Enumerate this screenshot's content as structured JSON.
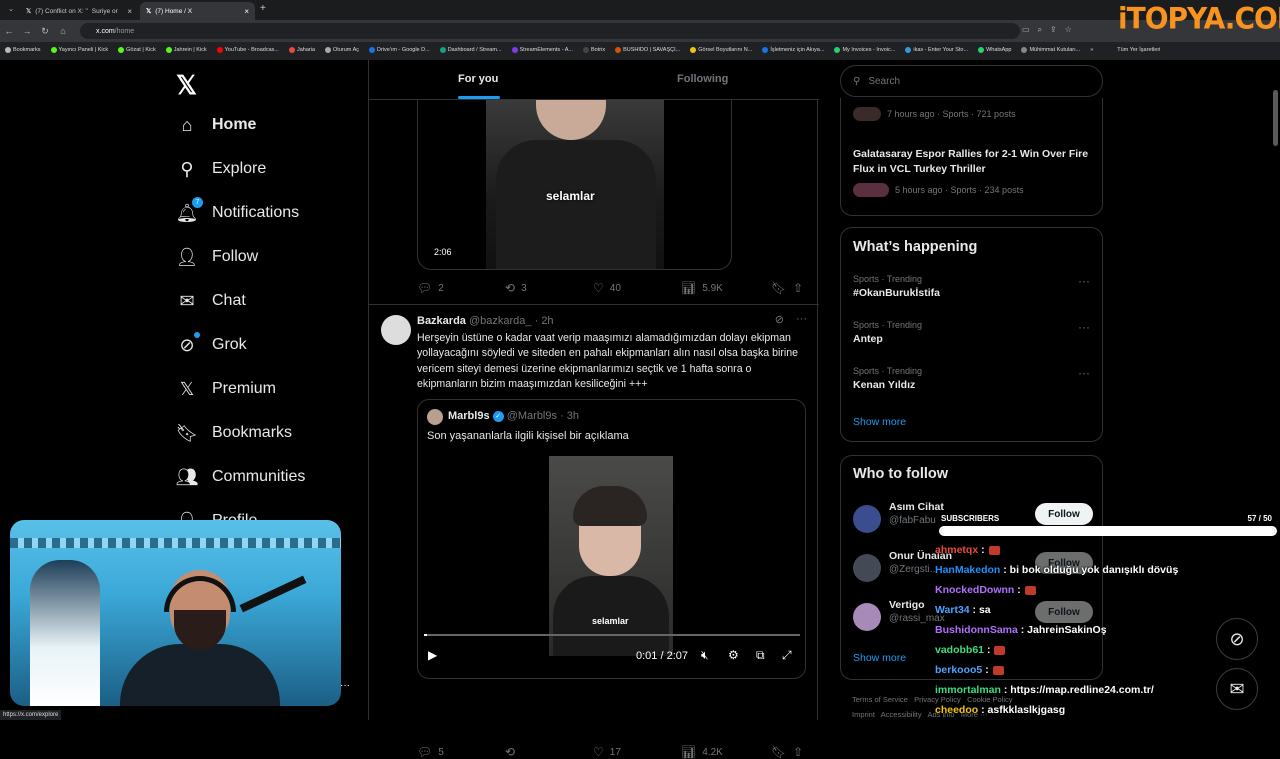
{
  "browser": {
    "tabs": [
      {
        "label": "(7) Conflict on X: \"",
        "active": false
      },
      {
        "label": "Suriye or",
        "active": false
      },
      {
        "label": "(7) Home / X",
        "active": true
      }
    ],
    "new_tab": "+",
    "url_host": "x.com",
    "url_path": "/home",
    "watermark": "iTOPYA.COM",
    "bookmarks": [
      "Bookmarks",
      "Yayıncı Paneli | Kick",
      "Gözat | Kick",
      "Jahrein | Kick",
      "YouTube - Broadcas...",
      "Jaharia",
      "Oturum Aç",
      "Drive'ım - Google D...",
      "Dashboard / Stream...",
      "StreamElements - A...",
      "Botrix",
      "BUSHIDO | SAVAŞÇI...",
      "Görsel Boyutlarını N...",
      "İşletmeniz için Akıya...",
      "My Invoices - Invoic...",
      "ikas - Enter Your Sto...",
      "WhatsApp",
      "Mühimmat Kutuları..."
    ],
    "bookmarks_more": "»",
    "all_bookmarks": "Tüm Yer İşaretleri",
    "status_url": "https://x.com/explore"
  },
  "nav": {
    "logo": "𝕏",
    "items": [
      {
        "label": "Home",
        "icon": "home-icon"
      },
      {
        "label": "Explore",
        "icon": "search-icon"
      },
      {
        "label": "Notifications",
        "icon": "bell-icon",
        "badge": "7"
      },
      {
        "label": "Follow",
        "icon": "person-plus-icon"
      },
      {
        "label": "Chat",
        "icon": "mail-icon"
      },
      {
        "label": "Grok",
        "icon": "grok-icon"
      },
      {
        "label": "Premium",
        "icon": "x-premium-icon"
      },
      {
        "label": "Bookmarks",
        "icon": "bookmark-icon"
      },
      {
        "label": "Communities",
        "icon": "communities-icon"
      },
      {
        "label": "Profile",
        "icon": "profile-icon"
      }
    ]
  },
  "feed": {
    "tabs": [
      "For you",
      "Following"
    ],
    "video1": {
      "caption": "selamlar",
      "duration": "2:06"
    },
    "post1_actions": {
      "replies": "2",
      "reposts": "3",
      "likes": "40",
      "views": "5.9K"
    },
    "tweet": {
      "name": "Bazkarda",
      "handle": "@bazkarda_",
      "time": "· 2h",
      "text": "Herşeyin üstüne o kadar vaat verip maaşımızı alamadığımızdan dolayı ekipman yollayacağını söyledi ve siteden en pahalı ekipmanları alın nasıl olsa başka birine vericem siteyi demesi üzerine ekipmanlarımızı seçtik ve 1 hafta sonra o ekipmanların bizim maaşımızdan kesiliceğini +++",
      "more": "···",
      "quote": {
        "name": "Marbl9s",
        "handle": "@Marbl9s",
        "time": "· 3h",
        "text": "Son yaşananlarla ilgili kişisel bir açıklama",
        "video_caption": "selamlar",
        "timecode": "0:01 / 2:07",
        "progress": 0.008
      },
      "actions": {
        "replies": "5",
        "reposts": "",
        "likes": "17",
        "views": "4.2K"
      }
    }
  },
  "sidebar": {
    "search_placeholder": "Search",
    "top_trends": [
      {
        "meta": "7 hours ago · Sports · 721 posts",
        "title": ""
      },
      {
        "title": "Galatasaray Espor Rallies for 2-1 Win Over Fire Flux in VCL Turkey Thriller",
        "meta": "5 hours ago · Sports · 234 posts"
      }
    ],
    "happening_title": "What’s happening",
    "trends": [
      {
        "meta": "Sports · Trending",
        "title": "#OkanBurukİstifa"
      },
      {
        "meta": "Sports · Trending",
        "title": "Antep"
      },
      {
        "meta": "Sports · Trending",
        "title": "Kenan Yıldız"
      }
    ],
    "show_more": "Show more",
    "who_to_follow_title": "Who to follow",
    "who_to_follow": [
      {
        "name": "Asım Cihat",
        "handle": "@fabFabu",
        "color": "#3b4d8f"
      },
      {
        "name": "Onur Ünalan",
        "handle": "@Zergsti...",
        "color": "#444a55"
      },
      {
        "name": "Vertigo",
        "handle": "@rassi_max",
        "color": "#a88ab8"
      }
    ],
    "follow_label": "Follow",
    "show_more_2": "Show more",
    "footer": [
      "Terms of Service",
      "Privacy Policy",
      "Cookie Policy",
      "Imprint",
      "Accessibility",
      "Ads info",
      "More ···"
    ]
  },
  "overlay": {
    "subs_label": "SUBSCRIBERS",
    "subs_count": "57",
    "subs_goal": "/ 50",
    "subs_progress": 1.0,
    "chat": [
      {
        "user": "ahmetqx",
        "color": "#e74c3c",
        "msg": ":",
        "emote": true
      },
      {
        "user": "HanMakedon",
        "color": "#1e90ff",
        "msg": ": bi bok olduğu yok danışıklı dövüş",
        "emote": false
      },
      {
        "user": "KnockedDownn",
        "color": "#b070ff",
        "msg": ":",
        "emote": true
      },
      {
        "user": "Wart34",
        "color": "#4aa3ff",
        "msg": ": sa",
        "emote": false
      },
      {
        "user": "BushidonnSama",
        "color": "#b070ff",
        "msg": ": JahreinSakinOş",
        "emote": false
      },
      {
        "user": "vadobb61",
        "color": "#3ddc84",
        "msg": ":",
        "emote": true
      },
      {
        "user": "berkooo5",
        "color": "#4aa3ff",
        "msg": ":",
        "emote": true
      },
      {
        "user": "immortalman",
        "color": "#3ddc84",
        "msg": ": https://map.redline24.com.tr/",
        "emote": false
      },
      {
        "user": "cheedoo",
        "color": "#f1c40f",
        "msg": ": asfkklaslkjgasg",
        "emote": false
      }
    ]
  },
  "colors": {
    "accent": "#1d9bf0",
    "background": "#000000",
    "border": "#2f3336"
  }
}
